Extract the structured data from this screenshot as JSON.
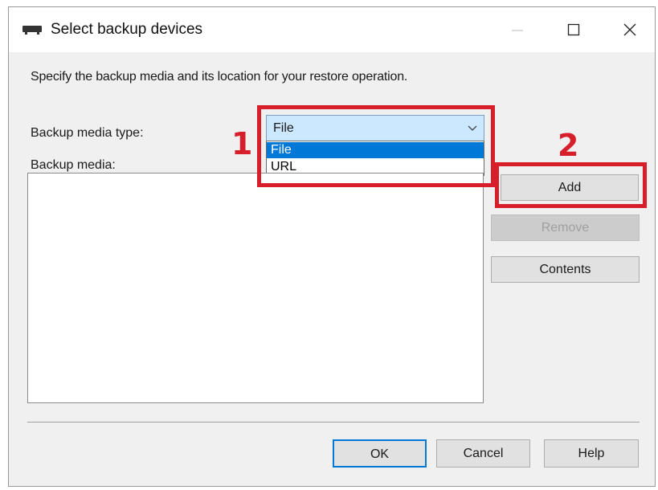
{
  "window": {
    "title": "Select backup devices",
    "icon": "tape-drive-icon",
    "controls": {
      "minimize": "minimize-icon",
      "maximize": "maximize-icon",
      "close": "close-icon"
    }
  },
  "dialog": {
    "instruction": "Specify the backup media and its location for your restore operation.",
    "media_type_label": "Backup media type:",
    "media_label": "Backup media:",
    "combo": {
      "selected": "File",
      "options": [
        "File",
        "URL"
      ],
      "highlighted_index": 0
    },
    "buttons": {
      "add": "Add",
      "remove": "Remove",
      "contents": "Contents",
      "ok": "OK",
      "cancel": "Cancel",
      "help": "Help"
    }
  },
  "annotations": {
    "step1": "1",
    "step2": "2",
    "color": "#d61f2a"
  },
  "colors": {
    "accent": "#0078d7",
    "combo_bg": "#cce8ff",
    "dialog_bg": "#f0f0f0"
  }
}
